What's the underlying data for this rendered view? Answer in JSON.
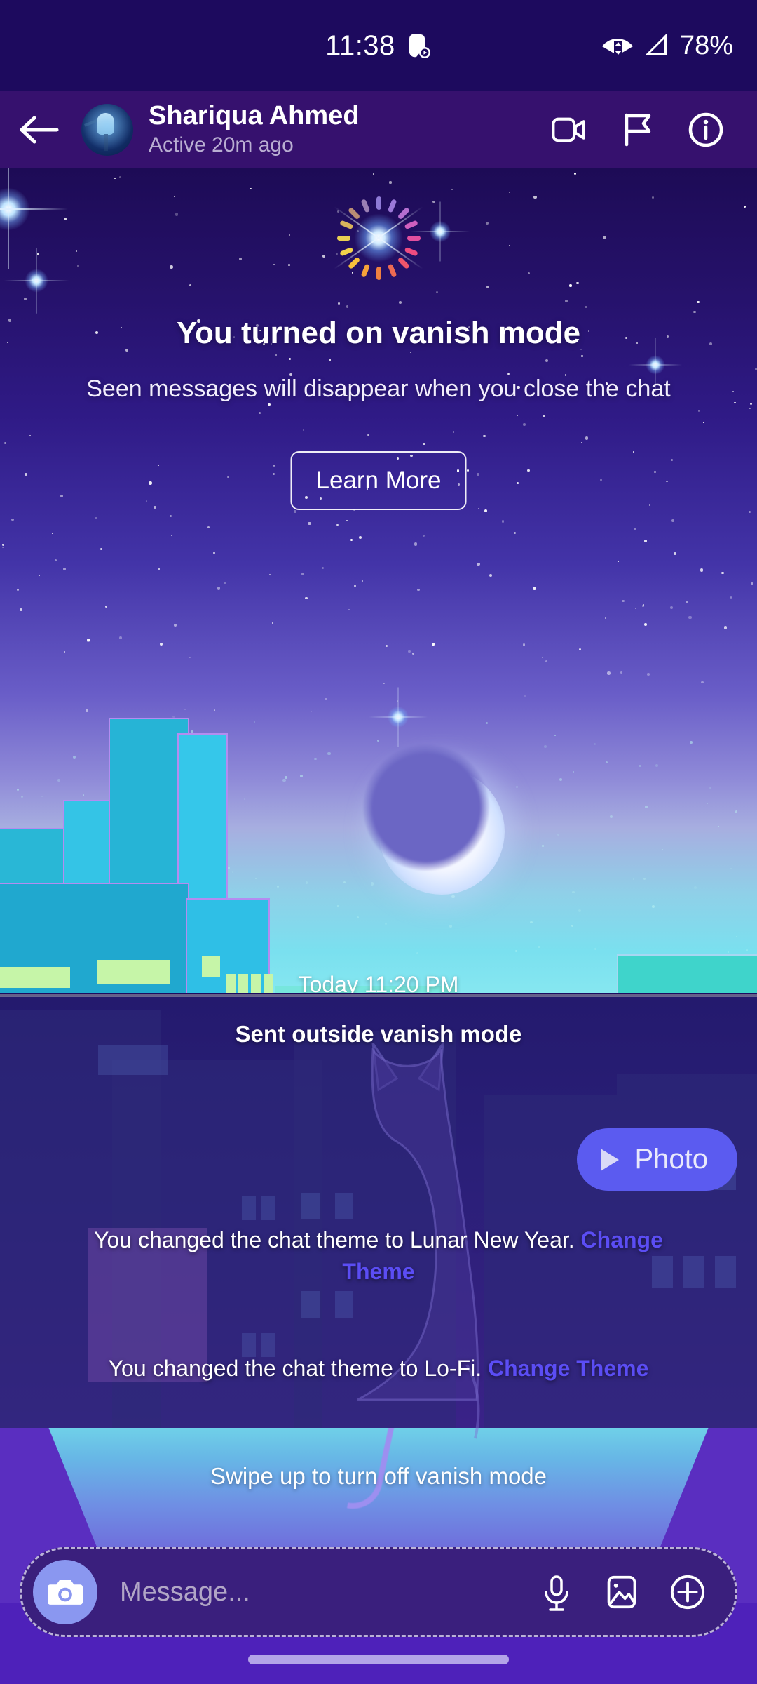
{
  "status_bar": {
    "time": "11:38",
    "center_icon": "camera-play-icon",
    "wifi_icon": "wifi-icon",
    "signal_icon": "cellular-signal-icon",
    "battery": "78%"
  },
  "header": {
    "back_icon": "back-arrow-icon",
    "avatar": "contact-avatar",
    "name": "Shariqua Ahmed",
    "status": "Active 20m ago",
    "actions": [
      {
        "icon": "video-call-icon"
      },
      {
        "icon": "flag-icon"
      },
      {
        "icon": "info-icon"
      }
    ]
  },
  "vanish": {
    "ring_icon": "vanish-mode-sparkle-icon",
    "title": "You turned on vanish mode",
    "subtitle": "Seen messages will disappear when you close the chat",
    "learn_more_label": "Learn More",
    "moon_icon": "crescent-moon-icon",
    "timestamp": "Today 11:20 PM"
  },
  "messages": {
    "sent_outside_label": "Sent outside vanish mode",
    "photo_bubble": {
      "play_icon": "play-triangle-icon",
      "label": "Photo"
    },
    "theme_changes": [
      {
        "text": "You changed the chat theme to Lunar New Year.",
        "link": "Change Theme"
      },
      {
        "text": "You changed the chat theme to Lo-Fi.",
        "link": "Change Theme"
      }
    ]
  },
  "swipe": {
    "hint": "Swipe up to turn off vanish mode"
  },
  "composer": {
    "camera_icon": "camera-icon",
    "input_value": "",
    "input_placeholder": "Message...",
    "actions": [
      {
        "icon": "microphone-icon"
      },
      {
        "icon": "gallery-icon"
      },
      {
        "icon": "plus-icon"
      }
    ]
  },
  "colors": {
    "status_bar_bg": "#1d0a5e",
    "header_bg": "#36116e",
    "accent_link": "#5b4df4",
    "photo_bubble": "#5b5bf0",
    "camera_button": "#8a97f0",
    "nav_bar": "#4e21ba"
  }
}
